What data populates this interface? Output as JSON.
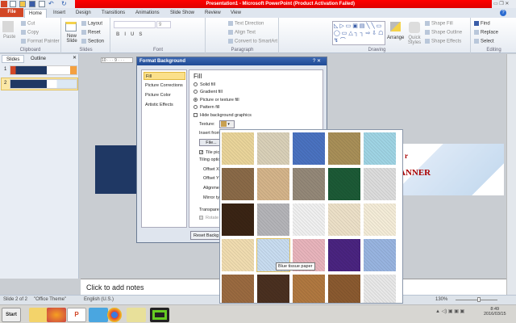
{
  "title": "Presentation1 - Microsoft PowerPoint (Product Activation Failed)",
  "tabs": [
    "File",
    "Home",
    "Insert",
    "Design",
    "Transitions",
    "Animations",
    "Slide Show",
    "Review",
    "View"
  ],
  "ribbon": {
    "clipboard": {
      "label": "Clipboard",
      "paste": "Paste",
      "cut": "Cut",
      "copy": "Copy",
      "format_painter": "Format Painter"
    },
    "slides": {
      "label": "Slides",
      "new_slide": "New Slide",
      "layout": "Layout",
      "reset": "Reset",
      "section": "Section"
    },
    "font": {
      "label": "Font",
      "size": "9"
    },
    "paragraph": {
      "label": "Paragraph",
      "text_direction": "Text Direction",
      "align_text": "Align Text",
      "convert": "Convert to SmartArt"
    },
    "drawing": {
      "label": "Drawing",
      "arrange": "Arrange",
      "quick_styles": "Quick Styles",
      "shape_fill": "Shape Fill",
      "shape_outline": "Shape Outline",
      "shape_effects": "Shape Effects"
    },
    "editing": {
      "label": "Editing",
      "find": "Find",
      "replace": "Replace",
      "select": "Select"
    }
  },
  "left_pane": {
    "tabs": [
      "Slides",
      "Outline"
    ],
    "slide_numbers": [
      "1",
      "2"
    ]
  },
  "ruler": "10 · · · 9 · · ·",
  "slide": {
    "title_partial": "r",
    "subtitle_partial": "ANNER"
  },
  "dialog": {
    "title": "Format Background",
    "categories": [
      "Fill",
      "Picture Corrections",
      "Picture Color",
      "Artistic Effects"
    ],
    "heading": "Fill",
    "options": [
      "Solid fill",
      "Gradient fill",
      "Picture or texture fill",
      "Pattern fill"
    ],
    "hide_bg": "Hide background graphics",
    "texture_label": "Texture:",
    "insert_from": "Insert from",
    "file_btn": "File...",
    "tile": "Tile pic",
    "tiling": "Tiling optio",
    "offset_x": "Offset X",
    "offset_y": "Offset Y",
    "alignment": "Alignmen",
    "mirror": "Mirror typ",
    "transparency": "Transpare",
    "rotate": "Rotate",
    "reset": "Reset Backg"
  },
  "gallery": {
    "tooltip": "Blue tissue paper",
    "colors": [
      "#e9d49a",
      "#d9d0b8",
      "#4a72c0",
      "#a88f58",
      "#9fd4e4",
      "#8a6a48",
      "#d4b48a",
      "#948878",
      "#1c5a36",
      "#dcdcdc",
      "#3a2414",
      "#b4b4b8",
      "#f0f0f0",
      "#ece0c8",
      "#f4ecd8",
      "#f0dcb0",
      "#c8dcf0",
      "#e8b4bc",
      "#4a2480",
      "#98b4e0",
      "#9a6a40",
      "#4a3020",
      "#b07840",
      "#8a5a30",
      "#e8e8e8"
    ]
  },
  "notes": "Click to add notes",
  "status": {
    "slide": "Slide 2 of 2",
    "theme": "\"Office Theme\"",
    "language": "English (U.S.)",
    "zoom": "130%"
  },
  "taskbar": {
    "start": "Start",
    "time": "8:49",
    "date": "2016/03/15"
  }
}
